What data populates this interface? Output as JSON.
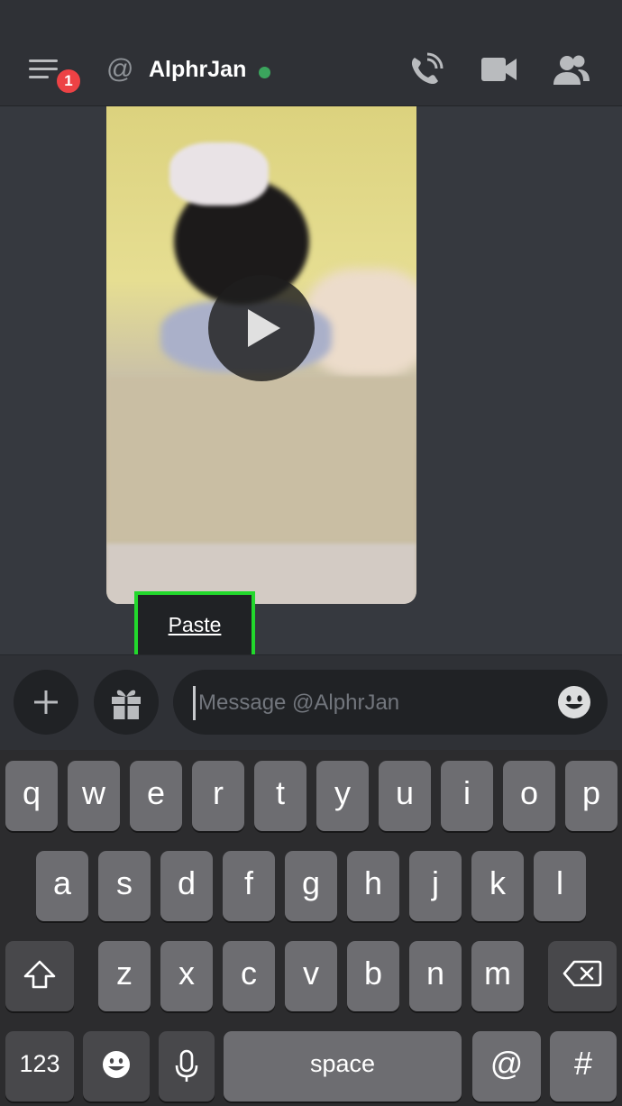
{
  "header": {
    "unread_count": "1",
    "at_symbol": "@",
    "user_name": "AlphrJan",
    "status_color": "#3ba55d",
    "icons": [
      "menu-icon",
      "at-icon",
      "voice-call-icon",
      "video-call-icon",
      "members-icon"
    ]
  },
  "chat": {
    "attachment": "video",
    "play_icon": "play-icon",
    "paste_label": "Paste"
  },
  "composer": {
    "add_icon": "plus-icon",
    "gift_icon": "gift-icon",
    "placeholder": "Message @AlphrJan",
    "emoji_icon": "emoji-icon"
  },
  "keyboard": {
    "row1": [
      "q",
      "w",
      "e",
      "r",
      "t",
      "y",
      "u",
      "i",
      "o",
      "p"
    ],
    "row2": [
      "a",
      "s",
      "d",
      "f",
      "g",
      "h",
      "j",
      "k",
      "l"
    ],
    "row3": [
      "z",
      "x",
      "c",
      "v",
      "b",
      "n",
      "m"
    ],
    "numbers_label": "123",
    "space_label": "space",
    "at_label": "@",
    "hash_label": "#",
    "icons": [
      "shift-icon",
      "backspace-icon",
      "emoji-keyboard-icon",
      "microphone-icon"
    ]
  },
  "colors": {
    "accent_highlight": "#22d82c",
    "badge": "#ed4245",
    "background": "#36393f"
  }
}
